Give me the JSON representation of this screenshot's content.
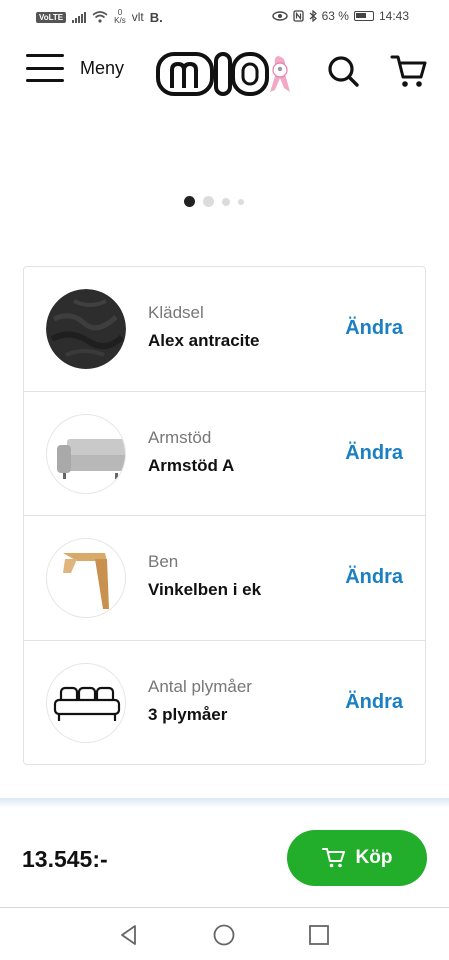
{
  "status_bar": {
    "volte": "VoLTE",
    "speed_value": "0",
    "speed_unit": "K/s",
    "carrier_extra": "vlt",
    "b_mark": "B.",
    "battery": "63 %",
    "time": "14:43"
  },
  "header": {
    "menu_label": "Meny",
    "logo_text": "MIO"
  },
  "carousel": {
    "dot_count": 4,
    "active_index": 0
  },
  "options": [
    {
      "label": "Klädsel",
      "value": "Alex antracite",
      "action": "Ändra",
      "thumb": "fabric-swatch"
    },
    {
      "label": "Armstöd",
      "value": "Armstöd A",
      "action": "Ändra",
      "thumb": "sofa-armrest"
    },
    {
      "label": "Ben",
      "value": "Vinkelben i ek",
      "action": "Ändra",
      "thumb": "wooden-leg"
    },
    {
      "label": "Antal plymåer",
      "value": "3 plymåer",
      "action": "Ändra",
      "thumb": "sofa-cushions-icon"
    }
  ],
  "buy_bar": {
    "price": "13.545:-",
    "buy_label": "Köp"
  },
  "colors": {
    "accent_link": "#1b7fc4",
    "buy_green": "#22ad2a",
    "logo_pink": "#f2a9c6"
  }
}
